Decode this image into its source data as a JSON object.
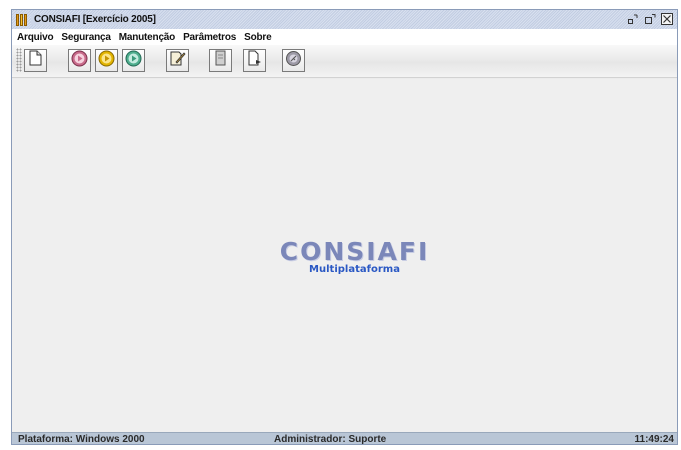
{
  "window": {
    "title": "CONSIAFI [Exercício 2005]",
    "app_icon": "app-logo-icon",
    "controls": [
      "minimize-icon",
      "maximize-icon",
      "close-icon"
    ]
  },
  "menubar": {
    "items": [
      {
        "label": "Arquivo"
      },
      {
        "label": "Segurança"
      },
      {
        "label": "Manutenção"
      },
      {
        "label": "Parâmetros"
      },
      {
        "label": "Sobre"
      }
    ]
  },
  "toolbar": {
    "buttons": [
      {
        "icon": "new-document-icon"
      },
      {
        "icon": "stop-record-icon"
      },
      {
        "icon": "play-yellow-icon"
      },
      {
        "icon": "play-green-icon"
      },
      {
        "icon": "edit-document-icon"
      },
      {
        "icon": "gray-document-icon"
      },
      {
        "icon": "export-document-icon"
      },
      {
        "icon": "settings-disc-icon"
      }
    ]
  },
  "content": {
    "logo_title": "CONSIAFI",
    "logo_subtitle": "Multiplataforma"
  },
  "statusbar": {
    "platform": "Plataforma: Windows 2000",
    "user": "Administrador: Suporte",
    "time": "11:49:24"
  },
  "colors": {
    "logo_title": "#7b87b9",
    "logo_subtitle": "#2a58c4",
    "status_bar": "#b9c6d6",
    "title_bar": "#cdd6e8"
  }
}
